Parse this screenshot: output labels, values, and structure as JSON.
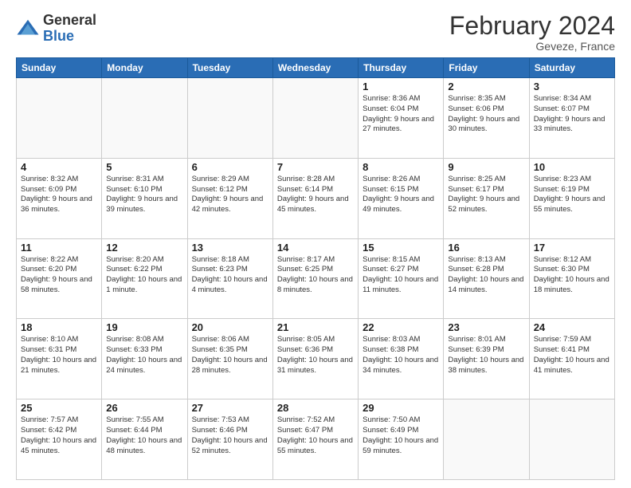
{
  "logo": {
    "general": "General",
    "blue": "Blue"
  },
  "header": {
    "title": "February 2024",
    "location": "Geveze, France"
  },
  "days_of_week": [
    "Sunday",
    "Monday",
    "Tuesday",
    "Wednesday",
    "Thursday",
    "Friday",
    "Saturday"
  ],
  "weeks": [
    [
      {
        "day": "",
        "info": ""
      },
      {
        "day": "",
        "info": ""
      },
      {
        "day": "",
        "info": ""
      },
      {
        "day": "",
        "info": ""
      },
      {
        "day": "1",
        "info": "Sunrise: 8:36 AM\nSunset: 6:04 PM\nDaylight: 9 hours and 27 minutes."
      },
      {
        "day": "2",
        "info": "Sunrise: 8:35 AM\nSunset: 6:06 PM\nDaylight: 9 hours and 30 minutes."
      },
      {
        "day": "3",
        "info": "Sunrise: 8:34 AM\nSunset: 6:07 PM\nDaylight: 9 hours and 33 minutes."
      }
    ],
    [
      {
        "day": "4",
        "info": "Sunrise: 8:32 AM\nSunset: 6:09 PM\nDaylight: 9 hours and 36 minutes."
      },
      {
        "day": "5",
        "info": "Sunrise: 8:31 AM\nSunset: 6:10 PM\nDaylight: 9 hours and 39 minutes."
      },
      {
        "day": "6",
        "info": "Sunrise: 8:29 AM\nSunset: 6:12 PM\nDaylight: 9 hours and 42 minutes."
      },
      {
        "day": "7",
        "info": "Sunrise: 8:28 AM\nSunset: 6:14 PM\nDaylight: 9 hours and 45 minutes."
      },
      {
        "day": "8",
        "info": "Sunrise: 8:26 AM\nSunset: 6:15 PM\nDaylight: 9 hours and 49 minutes."
      },
      {
        "day": "9",
        "info": "Sunrise: 8:25 AM\nSunset: 6:17 PM\nDaylight: 9 hours and 52 minutes."
      },
      {
        "day": "10",
        "info": "Sunrise: 8:23 AM\nSunset: 6:19 PM\nDaylight: 9 hours and 55 minutes."
      }
    ],
    [
      {
        "day": "11",
        "info": "Sunrise: 8:22 AM\nSunset: 6:20 PM\nDaylight: 9 hours and 58 minutes."
      },
      {
        "day": "12",
        "info": "Sunrise: 8:20 AM\nSunset: 6:22 PM\nDaylight: 10 hours and 1 minute."
      },
      {
        "day": "13",
        "info": "Sunrise: 8:18 AM\nSunset: 6:23 PM\nDaylight: 10 hours and 4 minutes."
      },
      {
        "day": "14",
        "info": "Sunrise: 8:17 AM\nSunset: 6:25 PM\nDaylight: 10 hours and 8 minutes."
      },
      {
        "day": "15",
        "info": "Sunrise: 8:15 AM\nSunset: 6:27 PM\nDaylight: 10 hours and 11 minutes."
      },
      {
        "day": "16",
        "info": "Sunrise: 8:13 AM\nSunset: 6:28 PM\nDaylight: 10 hours and 14 minutes."
      },
      {
        "day": "17",
        "info": "Sunrise: 8:12 AM\nSunset: 6:30 PM\nDaylight: 10 hours and 18 minutes."
      }
    ],
    [
      {
        "day": "18",
        "info": "Sunrise: 8:10 AM\nSunset: 6:31 PM\nDaylight: 10 hours and 21 minutes."
      },
      {
        "day": "19",
        "info": "Sunrise: 8:08 AM\nSunset: 6:33 PM\nDaylight: 10 hours and 24 minutes."
      },
      {
        "day": "20",
        "info": "Sunrise: 8:06 AM\nSunset: 6:35 PM\nDaylight: 10 hours and 28 minutes."
      },
      {
        "day": "21",
        "info": "Sunrise: 8:05 AM\nSunset: 6:36 PM\nDaylight: 10 hours and 31 minutes."
      },
      {
        "day": "22",
        "info": "Sunrise: 8:03 AM\nSunset: 6:38 PM\nDaylight: 10 hours and 34 minutes."
      },
      {
        "day": "23",
        "info": "Sunrise: 8:01 AM\nSunset: 6:39 PM\nDaylight: 10 hours and 38 minutes."
      },
      {
        "day": "24",
        "info": "Sunrise: 7:59 AM\nSunset: 6:41 PM\nDaylight: 10 hours and 41 minutes."
      }
    ],
    [
      {
        "day": "25",
        "info": "Sunrise: 7:57 AM\nSunset: 6:42 PM\nDaylight: 10 hours and 45 minutes."
      },
      {
        "day": "26",
        "info": "Sunrise: 7:55 AM\nSunset: 6:44 PM\nDaylight: 10 hours and 48 minutes."
      },
      {
        "day": "27",
        "info": "Sunrise: 7:53 AM\nSunset: 6:46 PM\nDaylight: 10 hours and 52 minutes."
      },
      {
        "day": "28",
        "info": "Sunrise: 7:52 AM\nSunset: 6:47 PM\nDaylight: 10 hours and 55 minutes."
      },
      {
        "day": "29",
        "info": "Sunrise: 7:50 AM\nSunset: 6:49 PM\nDaylight: 10 hours and 59 minutes."
      },
      {
        "day": "",
        "info": ""
      },
      {
        "day": "",
        "info": ""
      }
    ]
  ]
}
